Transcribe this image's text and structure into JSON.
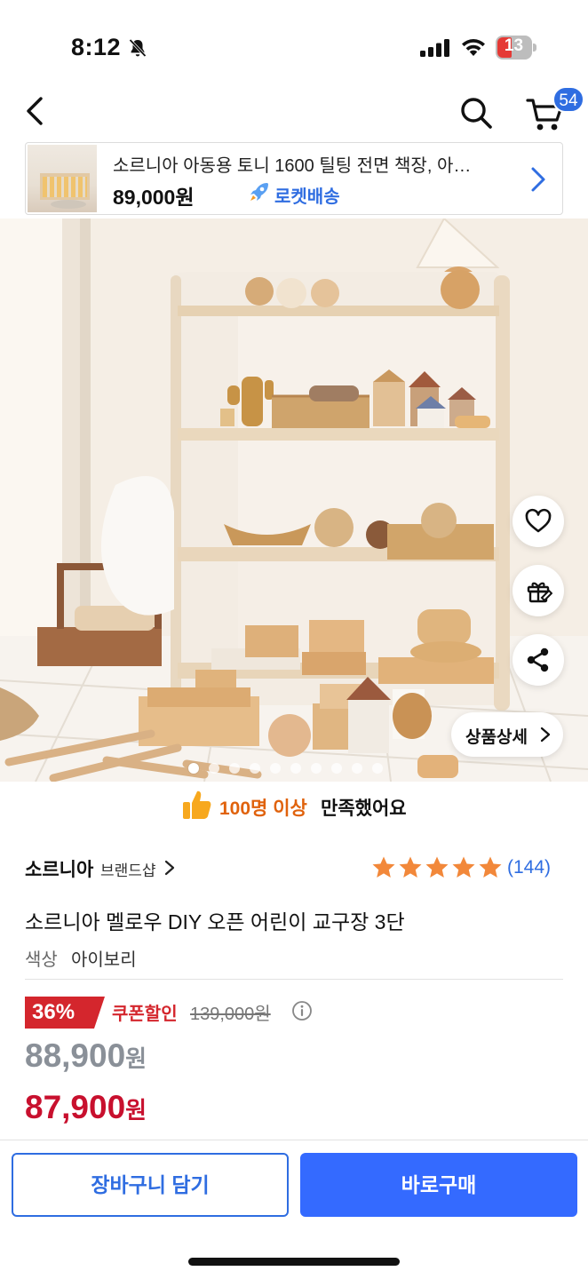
{
  "status_bar": {
    "time": "8:12",
    "battery": "13"
  },
  "nav": {
    "cart_count": "54"
  },
  "sticky_bar": {
    "title": "소르니아 아동용 토니 1600 틸팅 전면 책장, 아…",
    "price": "89,000원",
    "delivery": "로켓배송"
  },
  "gallery": {
    "detail_label": "상품상세",
    "page_count": 10,
    "active_index": 0
  },
  "satisfaction": {
    "highlight": "100명 이상",
    "text": "만족했어요"
  },
  "product": {
    "brand": "소르니아",
    "brand_shop": "브랜드샵",
    "rating": 5,
    "review_count": "(144)",
    "title": "소르니아 멜로우 DIY 오픈 어린이 교구장 3단",
    "option_label": "색상",
    "option_value": "아이보리"
  },
  "price": {
    "discount": "36%",
    "coupon_label": "쿠폰할인",
    "original": "139,000원",
    "sale_number": "88,900",
    "final_number": "87,900",
    "won": "원"
  },
  "actions": {
    "add_to_cart": "장바구니 담기",
    "buy_now": "바로구매"
  },
  "colors": {
    "accent_blue": "#346aff",
    "discount_red": "#c8102e",
    "satisfaction_orange": "#e0620c",
    "star_orange": "#f2883a"
  }
}
